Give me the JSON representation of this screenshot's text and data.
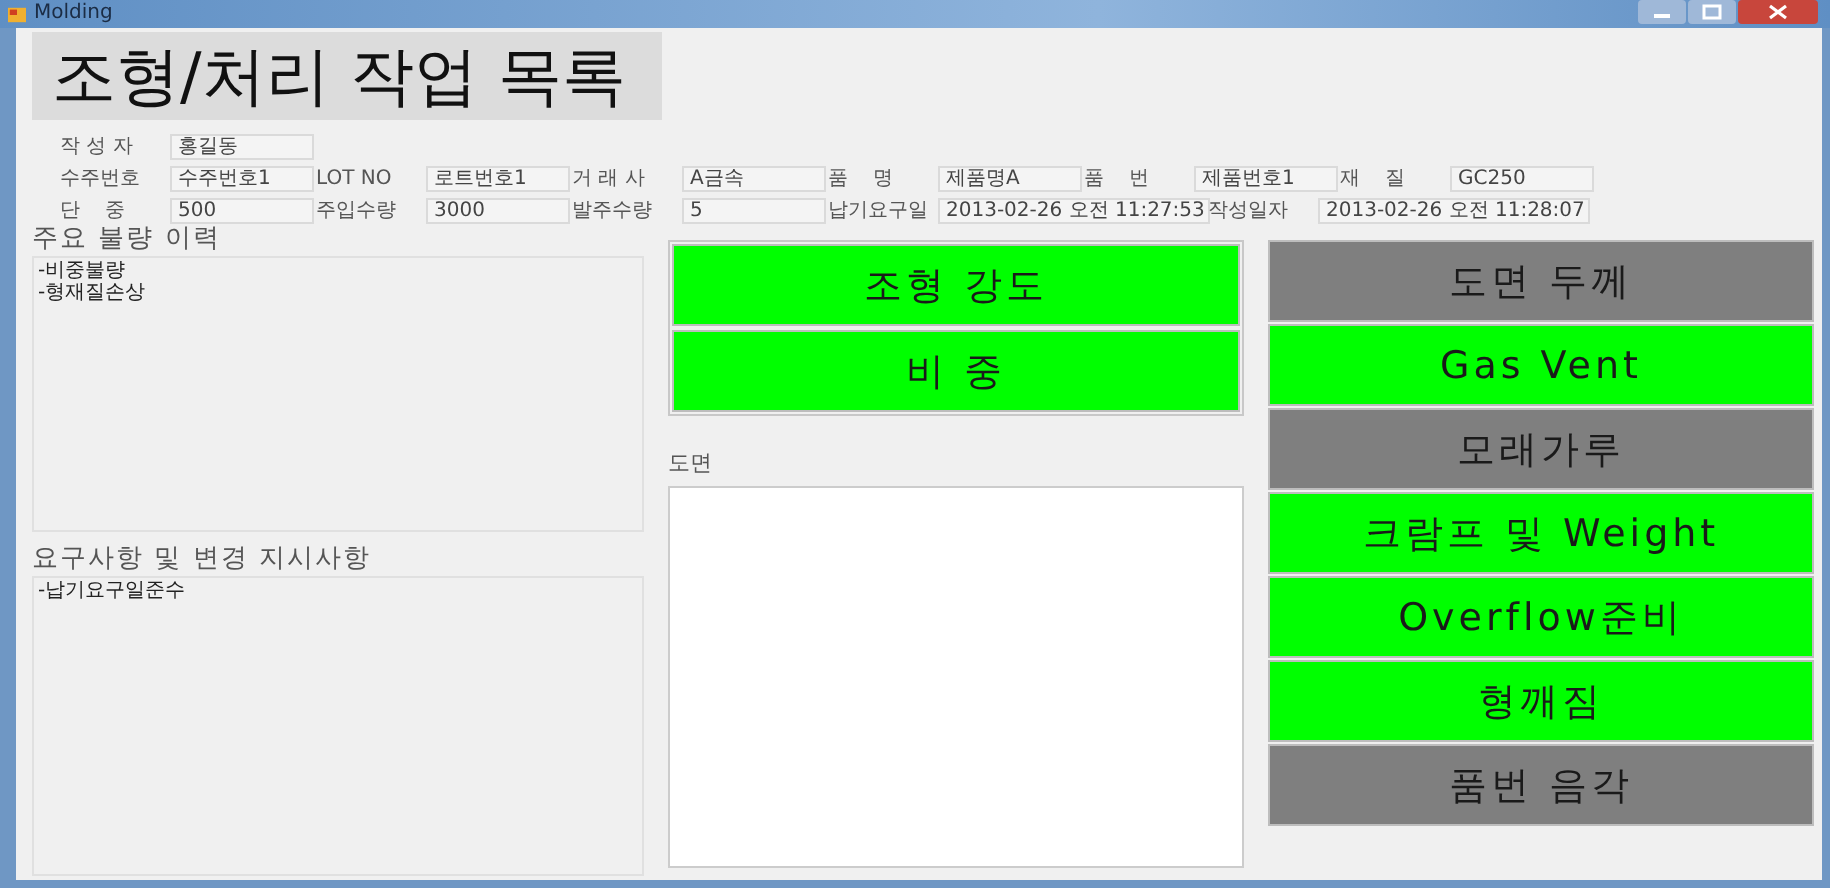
{
  "window": {
    "title": "Molding"
  },
  "heading": "조형/처리 작업 목록",
  "field_rows": [
    [
      {
        "label": "작 성 자",
        "value": "홍길동",
        "kind": "normal"
      }
    ],
    [
      {
        "label": "수주번호",
        "value": "수주번호1",
        "kind": "normal"
      },
      {
        "label": "LOT NO",
        "value": "로트번호1",
        "kind": "normal"
      },
      {
        "label": "거 래 사",
        "value": "A금속",
        "kind": "normal"
      },
      {
        "label": "품    명",
        "value": "제품명A",
        "kind": "normal"
      },
      {
        "label": "품    번",
        "value": "제품번호1",
        "kind": "normal"
      },
      {
        "label": "재    질",
        "value": "GC250",
        "kind": "normal"
      }
    ],
    [
      {
        "label": "단    중",
        "value": "500",
        "kind": "normal"
      },
      {
        "label": "주입수량",
        "value": "3000",
        "kind": "normal"
      },
      {
        "label": "발주수량",
        "value": "5",
        "kind": "normal"
      },
      {
        "label": "납기요구일",
        "value": "2013-02-26 오전 11:27:53",
        "kind": "wide"
      },
      {
        "label": "작성일자",
        "value": "2013-02-26 오전 11:28:07",
        "kind": "wide"
      }
    ]
  ],
  "defect_history": {
    "title": "주요 불량 이력",
    "lines": [
      "-비중불량",
      "-형재질손상"
    ]
  },
  "requirements": {
    "title": "요구사항 및 변경 지시사항",
    "lines": [
      "-납기요구일준수"
    ]
  },
  "middle_buttons": [
    {
      "label": "조형 강도",
      "done": true
    },
    {
      "label": "비 중",
      "done": true
    }
  ],
  "drawing": {
    "title": "도면"
  },
  "right_buttons": [
    {
      "label": "도면 두께",
      "done": false
    },
    {
      "label": "Gas Vent",
      "done": true
    },
    {
      "label": "모래가루",
      "done": false
    },
    {
      "label": "크람프 및 Weight",
      "done": true
    },
    {
      "label": "Overflow준비",
      "done": true
    },
    {
      "label": "형깨짐",
      "done": true
    },
    {
      "label": "품번 음각",
      "done": false
    }
  ]
}
